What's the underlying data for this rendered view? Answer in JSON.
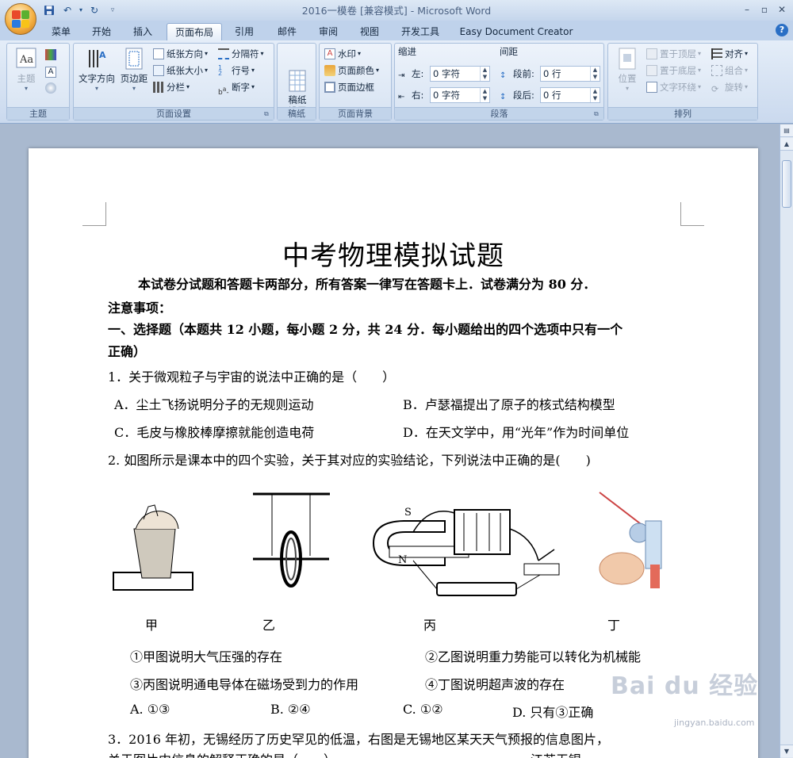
{
  "window": {
    "title": "2016一模卷 [兼容模式] - Microsoft Word",
    "quick_access": [
      "save-icon",
      "undo-icon",
      "redo-icon"
    ]
  },
  "tabs": [
    {
      "label": "菜单"
    },
    {
      "label": "开始"
    },
    {
      "label": "插入"
    },
    {
      "label": "页面布局",
      "active": true
    },
    {
      "label": "引用"
    },
    {
      "label": "邮件"
    },
    {
      "label": "审阅"
    },
    {
      "label": "视图"
    },
    {
      "label": "开发工具"
    },
    {
      "label": "Easy Document Creator"
    }
  ],
  "ribbon": {
    "theme_group": {
      "label": "主题",
      "theme_button": "主题"
    },
    "page_setup_group": {
      "label": "页面设置",
      "text_direction": "文字方向",
      "margins": "页边距",
      "orientation": "纸张方向",
      "size": "纸张大小",
      "columns": "分栏",
      "breaks": "分隔符",
      "line_numbers": "行号",
      "hyphenation": "断字"
    },
    "draft_group": {
      "label": "稿纸",
      "draft_setup": "稿纸\n设置"
    },
    "background_group": {
      "label": "页面背景",
      "watermark": "水印",
      "page_color": "页面颜色",
      "page_borders": "页面边框"
    },
    "paragraph_group": {
      "label": "段落",
      "indent_title": "缩进",
      "spacing_title": "间距",
      "indent_left_label": "左:",
      "indent_left_value": "0 字符",
      "indent_right_label": "右:",
      "indent_right_value": "0 字符",
      "space_before_label": "段前:",
      "space_before_value": "0 行",
      "space_after_label": "段后:",
      "space_after_value": "0 行"
    },
    "arrange_group": {
      "label": "排列",
      "position": "位置",
      "bring_front": "置于顶层",
      "send_back": "置于底层",
      "text_wrap": "文字环绕",
      "align": "对齐",
      "group": "组合",
      "rotate": "旋转"
    }
  },
  "document": {
    "title": "中考物理模拟试题",
    "intro": "本试卷分试题和答题卡两部分，所有答案一律写在答题卡上．试卷满分为 80 分．",
    "notice": "注意事项：",
    "section1_line1": "一、选择题（本题共 12 小题，每小题 2 分，共 24 分．每小题给出的四个选项中只有一个",
    "section1_line2": "正确）",
    "q1": "1．关于微观粒子与宇宙的说法中正确的是（　　）",
    "q1_options": {
      "A": "A．尘土飞扬说明分子的无规则运动",
      "B": "B．卢瑟福提出了原子的核式结构模型",
      "C": "C．毛皮与橡胶棒摩擦就能创造电荷",
      "D": "D．在天文学中，用“光年”作为时间单位"
    },
    "q2": "2. 如图所示是课本中的四个实验，关于其对应的实验结论，下列说法中正确的是(　　)",
    "q2_figures": {
      "jia": "甲",
      "yi": "乙",
      "bing": "丙",
      "ding": "丁",
      "s_label": "S",
      "n_label": "N"
    },
    "q2_statements": {
      "s1": "①甲图说明大气压强的存在",
      "s2": "②乙图说明重力势能可以转化为机械能",
      "s3": "③丙图说明通电导体在磁场受到力的作用",
      "s4": "④丁图说明超声波的存在"
    },
    "q2_options": {
      "A": "A. ①③",
      "B": "B. ②④",
      "C": "C. ①②",
      "D": "D. 只有③正确"
    },
    "q3_line1": "3．2016 年初，无锡经历了历史罕见的低温，右图是无锡地区某天天气预报的信息图片，",
    "q3_line2": "关于图片中信息的解释正确的是（　　）",
    "q3_side": "江苏无锡"
  },
  "watermark": {
    "text": "Bai du 经验",
    "url": "jingyan.baidu.com"
  }
}
